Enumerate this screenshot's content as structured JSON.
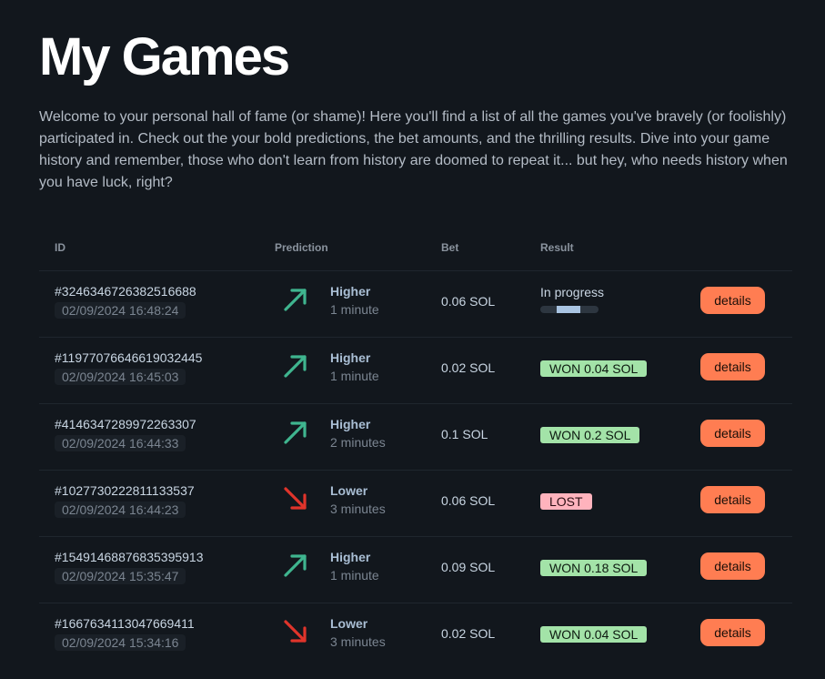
{
  "page": {
    "title": "My Games",
    "intro": "Welcome to your personal hall of fame (or shame)! Here you'll find a list of all the games you've bravely (or foolishly) participated in. Check out the your bold predictions, the bet amounts, and the thrilling results. Dive into your game history and remember, those who don't learn from history are doomed to repeat it... but hey, who needs history when you have luck, right?"
  },
  "table": {
    "headers": {
      "id": "ID",
      "prediction": "Prediction",
      "bet": "Bet",
      "result": "Result"
    },
    "details_label": "details",
    "rows": [
      {
        "id": "#3246346726382516688",
        "time": "02/09/2024 16:48:24",
        "direction": "Higher",
        "arrow_icon": "arrow-up-right-icon",
        "duration": "1 minute",
        "bet": "0.06 SOL",
        "result_type": "progress",
        "result": "In progress",
        "progress_fraction": 0.4
      },
      {
        "id": "#11977076646619032445",
        "time": "02/09/2024 16:45:03",
        "direction": "Higher",
        "arrow_icon": "arrow-up-right-icon",
        "duration": "1 minute",
        "bet": "0.02 SOL",
        "result_type": "won",
        "result": "WON 0.04 SOL"
      },
      {
        "id": "#4146347289972263307",
        "time": "02/09/2024 16:44:33",
        "direction": "Higher",
        "arrow_icon": "arrow-up-right-icon",
        "duration": "2 minutes",
        "bet": "0.1 SOL",
        "result_type": "won",
        "result": "WON 0.2 SOL"
      },
      {
        "id": "#1027730222811133537",
        "time": "02/09/2024 16:44:23",
        "direction": "Lower",
        "arrow_icon": "arrow-down-right-icon",
        "duration": "3 minutes",
        "bet": "0.06 SOL",
        "result_type": "lost",
        "result": "LOST"
      },
      {
        "id": "#15491468876835395913",
        "time": "02/09/2024 15:35:47",
        "direction": "Higher",
        "arrow_icon": "arrow-up-right-icon",
        "duration": "1 minute",
        "bet": "0.09 SOL",
        "result_type": "won",
        "result": "WON 0.18 SOL"
      },
      {
        "id": "#1667634113047669411",
        "time": "02/09/2024 15:34:16",
        "direction": "Lower",
        "arrow_icon": "arrow-down-right-icon",
        "duration": "3 minutes",
        "bet": "0.02 SOL",
        "result_type": "won",
        "result": "WON 0.04 SOL"
      }
    ]
  },
  "colors": {
    "background": "#12171d",
    "higher_arrow": "#3fb58f",
    "lower_arrow": "#e0342b",
    "won_badge": "#a3e3a8",
    "lost_badge": "#ffb3bd",
    "details_button": "#ff7d52",
    "progress_fill": "#a9c4e2"
  }
}
